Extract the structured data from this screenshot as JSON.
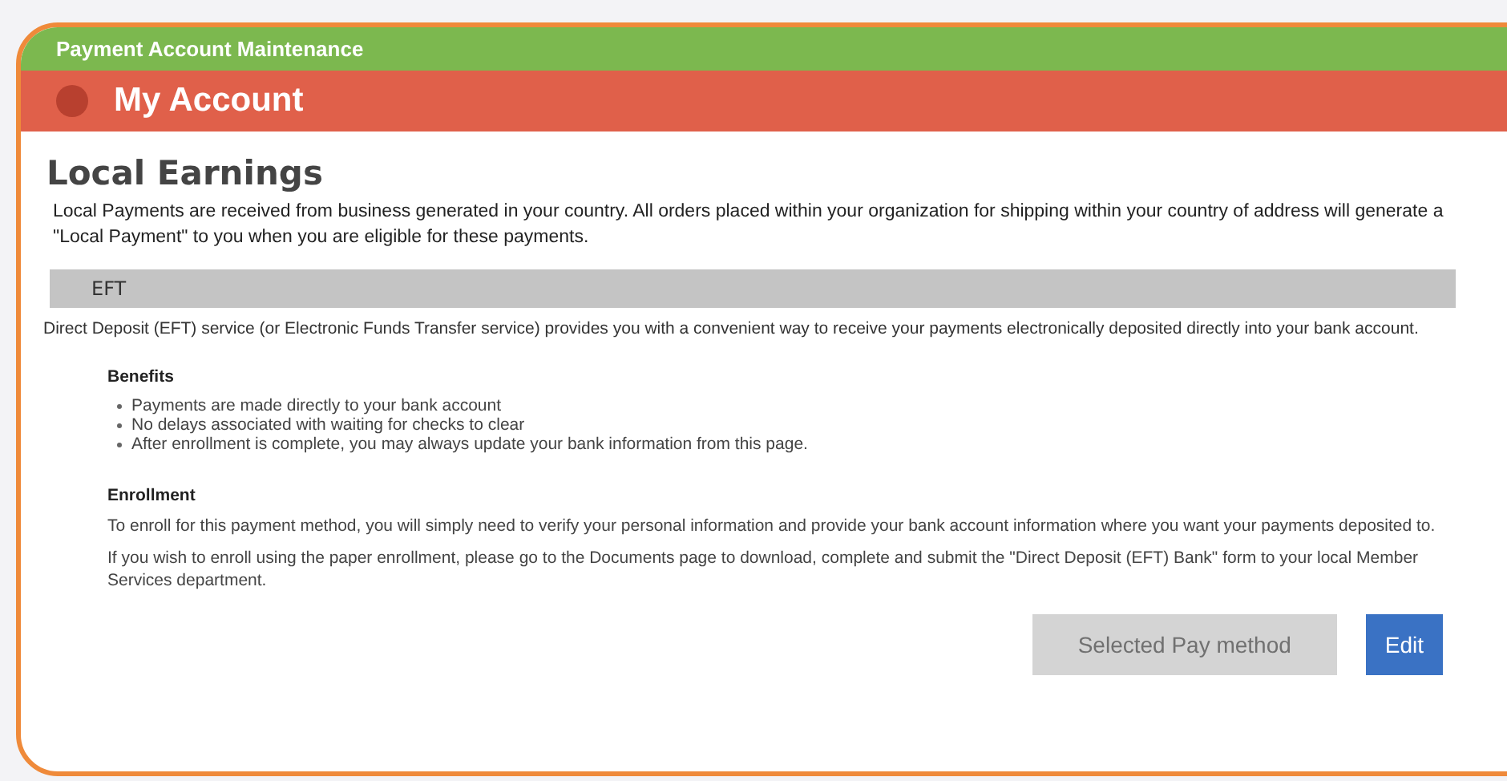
{
  "window": {
    "title": "Payment Account Maintenance"
  },
  "header": {
    "title": "My Account"
  },
  "page": {
    "heading": "Local Earnings",
    "intro": "Local Payments are received from business generated in your country. All orders placed within your organization for shipping within your country of address will generate a \"Local Payment\" to you when you are eligible for these payments."
  },
  "section": {
    "title": "EFT",
    "description": "Direct Deposit (EFT) service (or Electronic Funds Transfer service) provides you with a convenient way to receive your payments electronically deposited directly into your bank account.",
    "blocks": [
      {
        "heading": "Benefits",
        "kind": "list",
        "items": [
          "Payments are made directly to your bank account",
          "No delays associated with waiting for checks to clear",
          "After enrollment is complete, you may always update your bank information from this page."
        ]
      },
      {
        "heading": "Enrollment",
        "kind": "paragraphs",
        "items": [
          "To enroll for this payment method, you will simply need to verify your personal information and provide your bank account information where you want your payments deposited to.",
          "If you wish to enroll using the paper enrollment, please go to the Documents page to download, complete and submit the \"Direct Deposit (EFT) Bank\" form to your local Member Services department."
        ]
      }
    ]
  },
  "buttons": [
    {
      "label": "Selected Pay method",
      "disabled": true
    },
    {
      "label": "Edit",
      "disabled": false
    }
  ]
}
